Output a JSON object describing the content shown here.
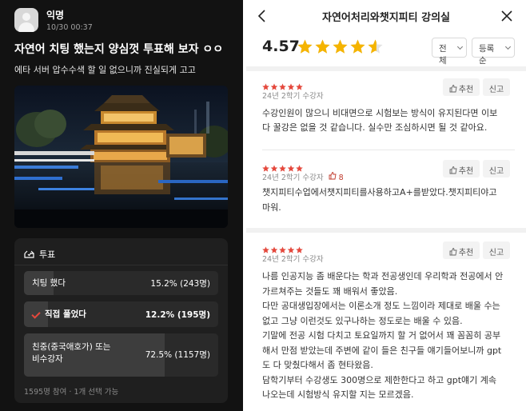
{
  "left": {
    "author": "익명",
    "time": "10/30 00:37",
    "title": "자연어 치팅 했는지 양심껏 투표해 보자 ㅇㅇ",
    "body": "에타 서버 압수수색 할 일 없으니까 진실되게 고고",
    "poll": {
      "header": "투표",
      "options": [
        {
          "label": "치팅 했다",
          "value": "15.2% (243명)",
          "pct": 15.2,
          "selected": false
        },
        {
          "label": "직접 풀었다",
          "value": "12.2% (195명)",
          "pct": 12.2,
          "selected": true
        },
        {
          "label": "친중(중국애호가) 또는\n비수강자",
          "value": "72.5% (1157명)",
          "pct": 72.5,
          "selected": false
        }
      ],
      "footer": "1595명 참여 · 1개 선택 가능"
    }
  },
  "right": {
    "title": "자연어처리와챗지피티 강의실",
    "rating": "4.57",
    "rating_value": 4.57,
    "sort": "전체",
    "order": "등록순",
    "recommend_label": "추천",
    "report_label": "신고",
    "reviews": [
      {
        "stars": 5,
        "semester": "24년 2학기 수강자",
        "likes": "",
        "lines": [
          "수강인원이 많으니 비대면으로 시험보는 방식이 유지된다면 이보",
          "다 꿀강은 없을 것 같습니다. 실수만 조심하시면 될 것 같아요."
        ]
      },
      {
        "stars": 5,
        "semester": "24년 2학기 수강자",
        "likes": "8",
        "lines": [
          "챗지피티수업에서챗지피티를사용하고A+를받았다.챗지피티야고",
          "마워."
        ]
      },
      {
        "stars": 5,
        "semester": "24년 2학기 수강자",
        "likes": "",
        "lines": [
          "나름 인공지능 좀 배운다는 학과 전공생인데 우리학과 전공에서 안",
          "가르쳐주는 것들도 꽤 배워서 좋았음.",
          "다만 공대생입장에서는 이론소개 정도 느낌이라 제대로 배울 수는",
          "없고 그냥 이런것도 있구나하는 정도로는 배울 수 있음.",
          "기말에 전공 시험 다치고 토요일까지 할 거 없어서 꽤 꼼꼼히 공부",
          "해서 만점 받았는데 주변에 같이 들은 친구들 얘기들어보니까 gpt",
          "도 다 맞췄다해서 좀 현타왔음.",
          "담학기부터 수강생도 300명으로 제한한다고 하고 gpt얘기 계속",
          "나오는데 시험방식 유지할 지는 모르겠음."
        ]
      }
    ]
  },
  "colors": {
    "accent_red": "#e5483c",
    "star_gold": "#f5b400",
    "dark_bg": "#121212"
  }
}
